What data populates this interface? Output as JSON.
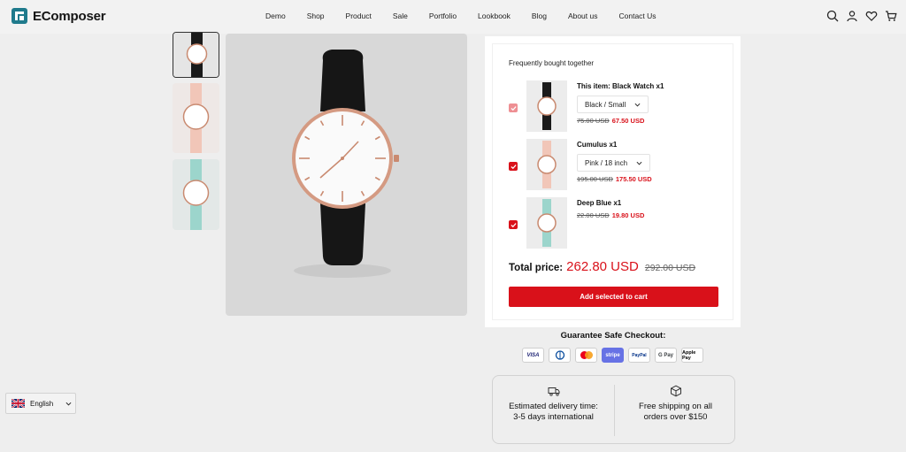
{
  "brand": {
    "name": "EComposer",
    "accent": "#1f7a8c"
  },
  "nav": {
    "items": [
      "Demo",
      "Shop",
      "Product",
      "Sale",
      "Portfolio",
      "Lookbook",
      "Blog",
      "About us",
      "Contact Us"
    ]
  },
  "header_icons": [
    "search-icon",
    "user-icon",
    "heart-icon",
    "cart-icon"
  ],
  "fbt": {
    "title": "Frequently bought together",
    "items": [
      {
        "name": "This item: Black Watch x1",
        "variant": "Black / Small",
        "old_price": "75.00 USD",
        "new_price": "67.50 USD",
        "checked": true,
        "strap": "#1a1a1a"
      },
      {
        "name": "Cumulus x1",
        "variant": "Pink / 18 inch",
        "old_price": "195.00 USD",
        "new_price": "175.50 USD",
        "checked": true,
        "strap": "#f1c6b8"
      },
      {
        "name": "Deep Blue x1",
        "variant": "",
        "old_price": "22.00 USD",
        "new_price": "19.80 USD",
        "checked": true,
        "strap": "#9cd5cc"
      }
    ],
    "total_label": "Total price:",
    "total_value": "262.80 USD",
    "total_old": "292.00 USD",
    "add_button": "Add selected to cart"
  },
  "guarantee": {
    "title": "Guarantee Safe Checkout:",
    "payments": [
      "VISA",
      "Diners",
      "Mastercard",
      "stripe",
      "PayPal",
      "G Pay",
      "Apple Pay"
    ]
  },
  "info": {
    "delivery": "Estimated delivery time: 3-5 days international",
    "shipping": "Free shipping on all orders over $150"
  },
  "language": {
    "label": "English"
  },
  "colors": {
    "accent_red": "#d9111a"
  }
}
